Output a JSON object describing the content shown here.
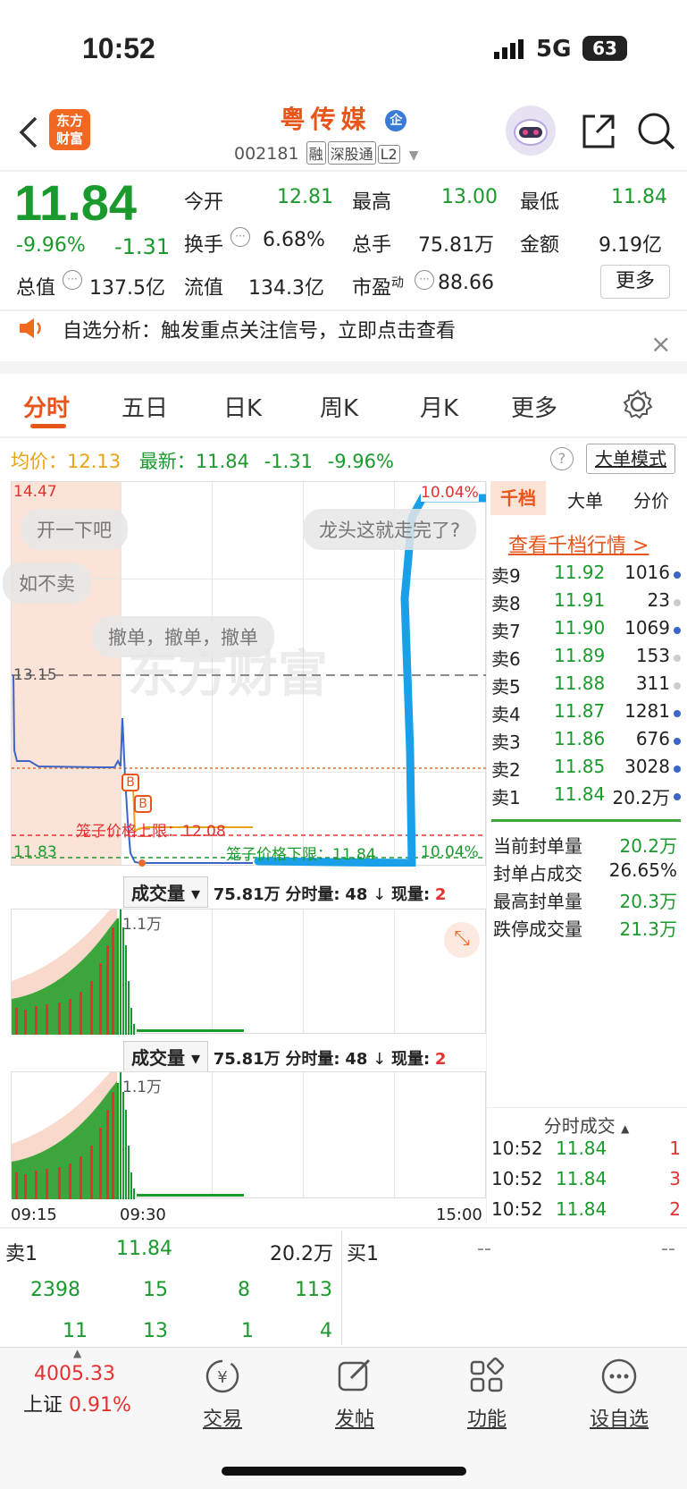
{
  "status": {
    "time": "10:52",
    "network": "5G",
    "battery": "63"
  },
  "header": {
    "logo_text": "东方\n财富",
    "stock_name": "粤传媒",
    "badge": "企",
    "code": "002181",
    "tags": [
      "融",
      "深股通",
      "L2"
    ]
  },
  "quote": {
    "price": "11.84",
    "pct": "-9.96%",
    "change": "-1.31",
    "open_label": "今开",
    "open": "12.81",
    "high_label": "最高",
    "high": "13.00",
    "low_label": "最低",
    "low": "11.84",
    "turnover_label": "换手",
    "turnover": "6.68%",
    "volume_label": "总手",
    "volume": "75.81万",
    "amount_label": "金额",
    "amount": "9.19亿",
    "mktcap_label": "总值",
    "mktcap": "137.5亿",
    "float_label": "流值",
    "float": "134.3亿",
    "pe_label": "市盈",
    "pe_sup": "动",
    "pe": "88.66",
    "more": "更多"
  },
  "notice": {
    "text": "自选分析：触发重点关注信号，立即点击查看",
    "close": "×"
  },
  "tabs": [
    "分时",
    "五日",
    "日K",
    "周K",
    "月K",
    "更多"
  ],
  "chart_info": {
    "avg_label": "均价：",
    "avg": "12.13",
    "latest_label": "最新：",
    "latest": "11.84",
    "latest_change": "-1.31",
    "latest_pct": "-9.96%",
    "big_order": "大单模式"
  },
  "chart": {
    "y_top": "14.47",
    "y_mid": "13.15",
    "y_bottom": "11.83",
    "pct_top": "10.04%",
    "pct_bottom": "10.04%",
    "upper_limit": "笼子价格上限：12.08",
    "lower_limit": "笼子价格下限：11.84",
    "watermark": "东方财富",
    "bubbles": [
      "开一下吧",
      "龙头这就走完了?",
      "如不卖",
      "撤单，撤单，撤单"
    ],
    "marker": "B"
  },
  "chart_data": {
    "type": "line",
    "x": [
      "09:15",
      "09:30",
      "15:00"
    ],
    "series": [],
    "ylim": [
      11.83,
      14.47
    ]
  },
  "volume": {
    "label": "成交量",
    "total": "75.81万",
    "fenshi_label": "分时量:",
    "fenshi": "48",
    "now_label": "现量:",
    "now": "2",
    "peak": "1.1万"
  },
  "time_axis": [
    "09:15",
    "09:30",
    "15:00"
  ],
  "orderbook": {
    "tabs": [
      "千档",
      "大单",
      "分价"
    ],
    "link": "查看千档行情 >",
    "asks": [
      {
        "label": "卖9",
        "price": "11.92",
        "vol": "1016"
      },
      {
        "label": "卖8",
        "price": "11.91",
        "vol": "23"
      },
      {
        "label": "卖7",
        "price": "11.90",
        "vol": "1069"
      },
      {
        "label": "卖6",
        "price": "11.89",
        "vol": "153"
      },
      {
        "label": "卖5",
        "price": "11.88",
        "vol": "311"
      },
      {
        "label": "卖4",
        "price": "11.87",
        "vol": "1281"
      },
      {
        "label": "卖3",
        "price": "11.86",
        "vol": "676"
      },
      {
        "label": "卖2",
        "price": "11.85",
        "vol": "3028"
      },
      {
        "label": "卖1",
        "price": "11.84",
        "vol": "20.2万"
      }
    ],
    "seal": [
      {
        "label": "当前封单量",
        "value": "20.2万"
      },
      {
        "label": "封单占成交",
        "value": "26.65%"
      },
      {
        "label": "最高封单量",
        "value": "20.3万"
      },
      {
        "label": "跌停成交量",
        "value": "21.3万"
      }
    ],
    "ticks_title": "分时成交",
    "ticks": [
      {
        "time": "10:52",
        "price": "11.84",
        "vol": "1"
      },
      {
        "time": "10:52",
        "price": "11.84",
        "vol": "3"
      },
      {
        "time": "10:52",
        "price": "11.84",
        "vol": "2"
      }
    ]
  },
  "level": {
    "sell_label": "卖1",
    "sell_price": "11.84",
    "sell_vol": "20.2万",
    "buy_label": "买1",
    "buy_price": "--",
    "buy_vol": "--",
    "row1": [
      "2398",
      "15",
      "8",
      "113"
    ],
    "row2": [
      "11",
      "13",
      "1",
      "4"
    ]
  },
  "index": {
    "value": "4005.33",
    "name": "上证",
    "pct": "0.91%"
  },
  "nav": [
    "交易",
    "发帖",
    "功能",
    "设自选"
  ]
}
